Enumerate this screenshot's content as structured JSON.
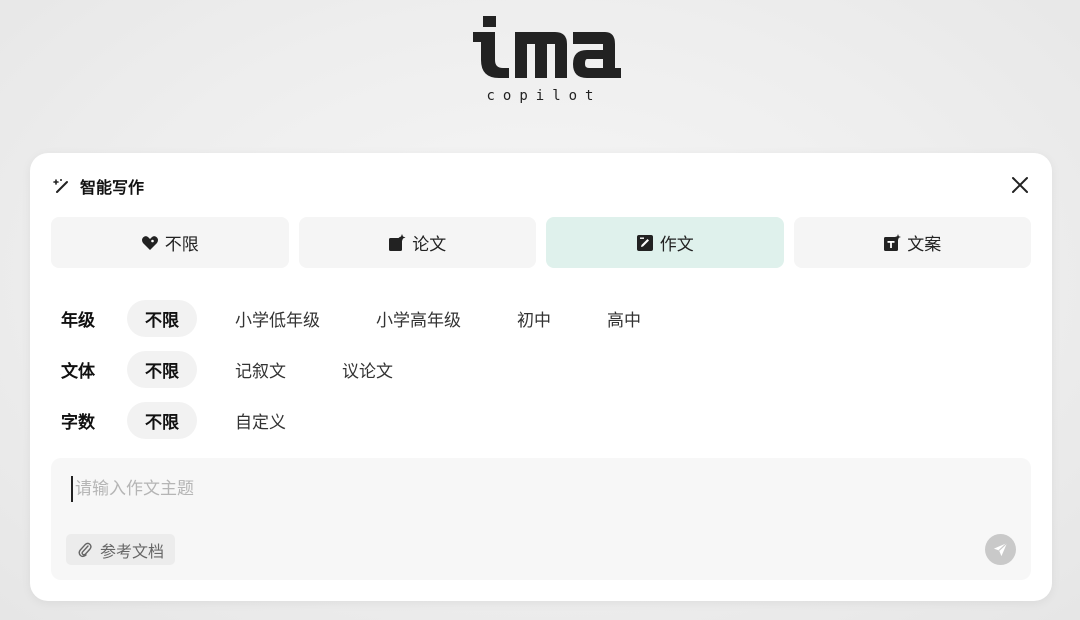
{
  "logo": {
    "brand": "ima",
    "subtitle": "copilot"
  },
  "panel": {
    "title": "智能写作",
    "icon": "magic-wand-icon"
  },
  "tabs": [
    {
      "label": "不限",
      "icon": "heart-bubble-icon",
      "active": false
    },
    {
      "label": "论文",
      "icon": "paper-spark-icon",
      "active": false
    },
    {
      "label": "作文",
      "icon": "edit-square-icon",
      "active": true
    },
    {
      "label": "文案",
      "icon": "text-spark-icon",
      "active": false
    }
  ],
  "filters": {
    "grade": {
      "label": "年级",
      "options": [
        "不限",
        "小学低年级",
        "小学高年级",
        "初中",
        "高中"
      ],
      "selected": "不限"
    },
    "style": {
      "label": "文体",
      "options": [
        "不限",
        "记叙文",
        "议论文"
      ],
      "selected": "不限"
    },
    "wordcount": {
      "label": "字数",
      "options": [
        "不限",
        "自定义"
      ],
      "selected": "不限"
    }
  },
  "input": {
    "placeholder": "请输入作文主题",
    "value": ""
  },
  "reference": {
    "label": "参考文档",
    "icon": "paperclip-icon"
  },
  "send": {
    "icon": "send-icon"
  },
  "colors": {
    "active_tab": "#dff1ec",
    "send_disabled": "#c9c9c9"
  }
}
